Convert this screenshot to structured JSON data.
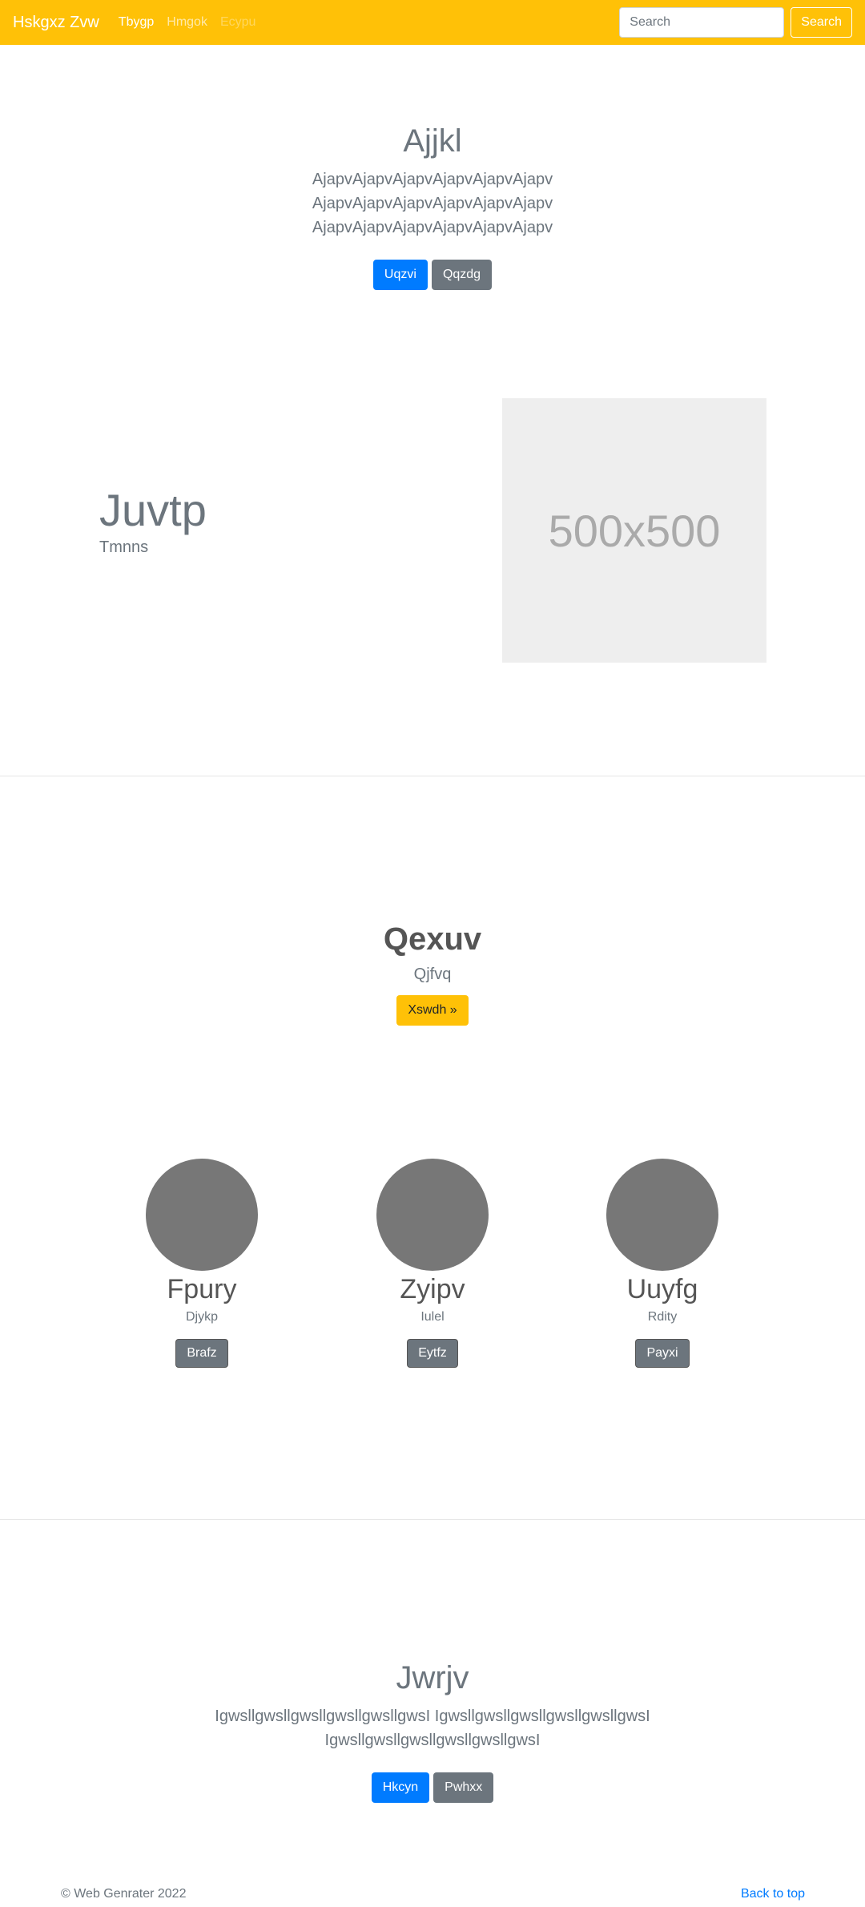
{
  "navbar": {
    "brand": "Hskgxz Zvw",
    "links": [
      "Tbygp",
      "Hmgok",
      "Ecypu"
    ],
    "search_placeholder": "Search",
    "search_button": "Search"
  },
  "hero": {
    "title": "Ajjkl",
    "lead": "AjapvAjapvAjapvAjapvAjapvAjapv AjapvAjapvAjapvAjapvAjapvAjapv AjapvAjapvAjapvAjapvAjapvAjapv",
    "buttons": [
      "Uqzvi",
      "Qqzdg"
    ]
  },
  "feature": {
    "title": "Juvtp",
    "subtitle": "Tmnns",
    "image_label": "500x500"
  },
  "cta": {
    "title": "Qexuv",
    "subtitle": "Qjfvq",
    "button": "Xswdh »"
  },
  "cards": [
    {
      "title": "Fpury",
      "subtitle": "Djykp",
      "button": "Brafz"
    },
    {
      "title": "Zyipv",
      "subtitle": "Iulel",
      "button": "Eytfz"
    },
    {
      "title": "Uuyfg",
      "subtitle": "Rdity",
      "button": "Payxi"
    }
  ],
  "final": {
    "title": "Jwrjv",
    "lead": "IgwsllgwsllgwsllgwsllgwsllgwsI IgwsllgwsllgwsllgwsllgwsllgwsI IgwsllgwsllgwsllgwsllgwsllgwsI",
    "buttons": [
      "Hkcyn",
      "Pwhxx"
    ]
  },
  "footer": {
    "copyright": "© Web Genrater 2022",
    "back_to_top": "Back to top"
  },
  "colors": {
    "navbar": "#ffc107",
    "primary": "#007bff",
    "secondary": "#6c757d"
  }
}
